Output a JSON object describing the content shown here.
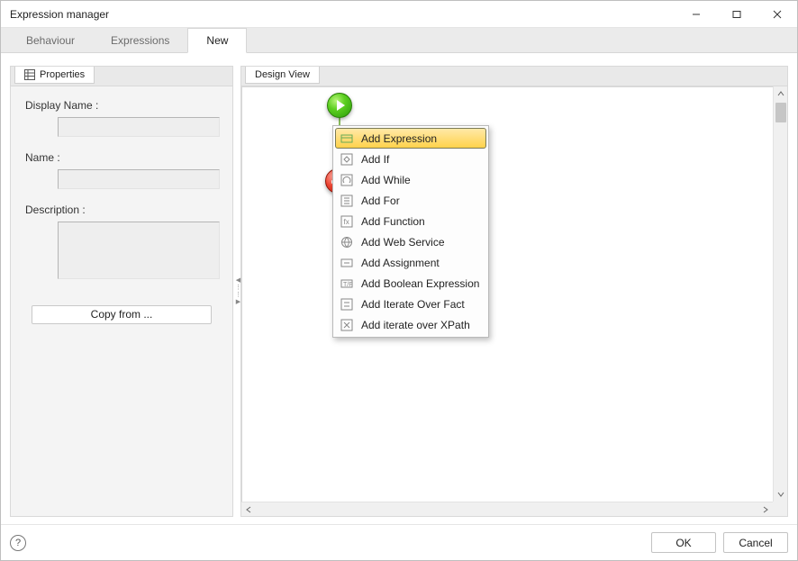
{
  "window": {
    "title": "Expression manager"
  },
  "tabs": {
    "items": [
      "Behaviour",
      "Expressions",
      "New"
    ],
    "active": 2
  },
  "leftPanel": {
    "title": "Properties",
    "fields": {
      "displayName": {
        "label": "Display Name :",
        "value": ""
      },
      "name": {
        "label": "Name :",
        "value": ""
      },
      "description": {
        "label": "Description :",
        "value": ""
      }
    },
    "copyFrom": "Copy from ..."
  },
  "rightPanel": {
    "title": "Design View"
  },
  "contextMenu": {
    "selected": 0,
    "items": [
      "Add Expression",
      "Add If",
      "Add While",
      "Add For",
      "Add Function",
      "Add Web Service",
      "Add Assignment",
      "Add Boolean Expression",
      "Add Iterate Over Fact",
      "Add iterate over XPath"
    ]
  },
  "footer": {
    "ok": "OK",
    "cancel": "Cancel"
  }
}
